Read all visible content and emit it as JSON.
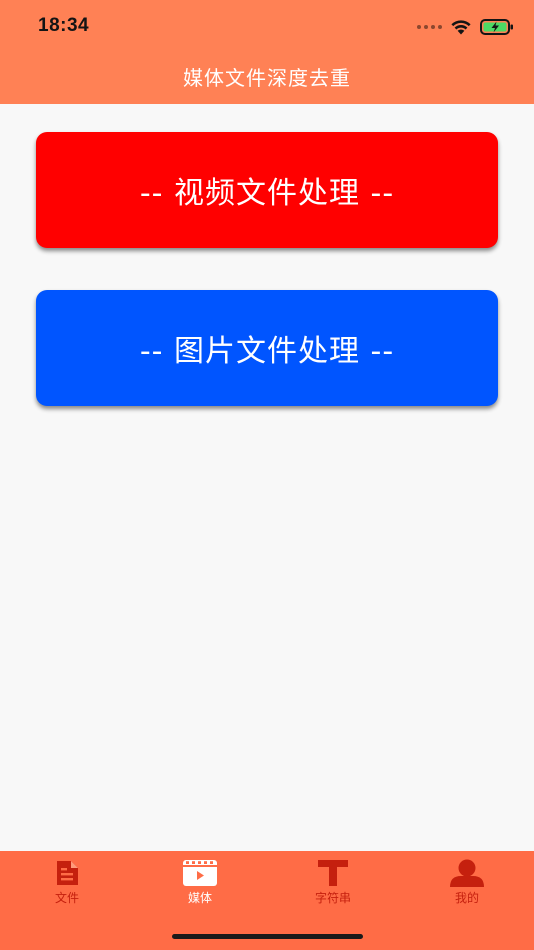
{
  "status_bar": {
    "time": "18:34"
  },
  "header": {
    "title": "媒体文件深度去重"
  },
  "buttons": {
    "video": {
      "label": "-- 视频文件处理 --",
      "color": "#ff0000"
    },
    "image": {
      "label": "-- 图片文件处理 --",
      "color": "#0055ff"
    }
  },
  "tabbar": {
    "items": [
      {
        "label": "文件",
        "icon": "document-icon",
        "active": false
      },
      {
        "label": "媒体",
        "icon": "video-play-icon",
        "active": true
      },
      {
        "label": "字符串",
        "icon": "text-t-icon",
        "active": false
      },
      {
        "label": "我的",
        "icon": "person-icon",
        "active": false
      }
    ]
  },
  "colors": {
    "header_bg": "#ff8155",
    "tabbar_bg": "#ff6c46",
    "tab_inactive": "#c5200e",
    "tab_active": "#ffffff",
    "page_bg": "#f8f8f8"
  }
}
